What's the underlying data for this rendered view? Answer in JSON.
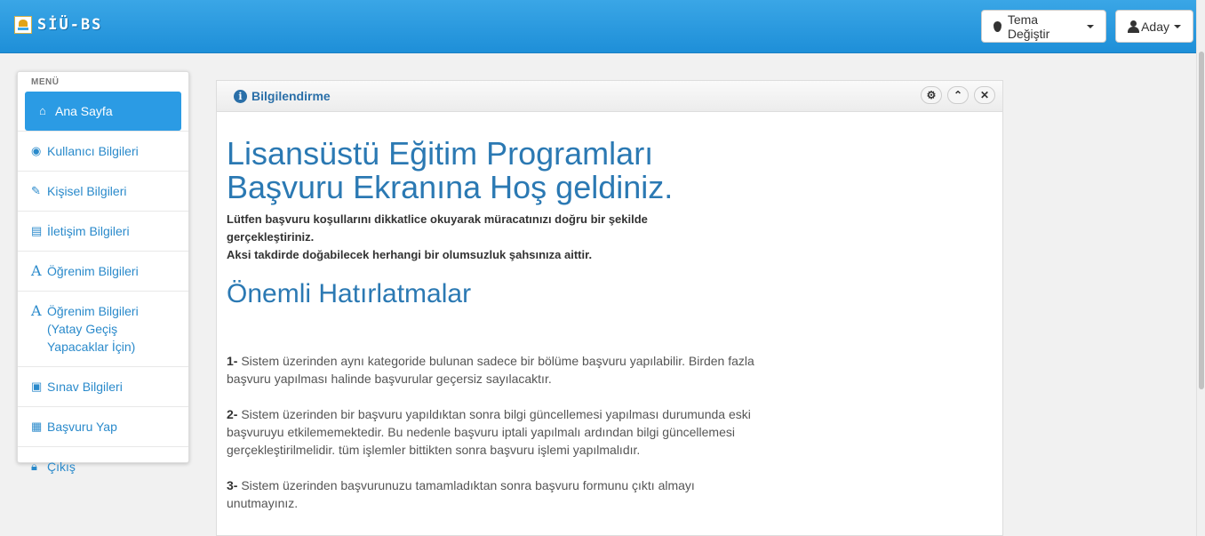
{
  "brand": {
    "name": "SİÜ-BS"
  },
  "navbar": {
    "theme_button": "Tema Değiştir",
    "user_button": "Aday"
  },
  "sidebar": {
    "title": "MENÜ",
    "items": [
      {
        "label": "Ana Sayfa",
        "icon": "home-icon"
      },
      {
        "label": "Kullanıcı Bilgileri",
        "icon": "eye-icon"
      },
      {
        "label": "Kişisel Bilgileri",
        "icon": "edit-icon"
      },
      {
        "label": "İletişim Bilgileri",
        "icon": "list-icon"
      },
      {
        "label": "Öğrenim Bilgileri",
        "icon": "font-icon"
      },
      {
        "label": "Öğrenim Bilgileri (Yatay Geçiş Yapacaklar İçin)",
        "icon": "font-icon"
      },
      {
        "label": "Sınav Bilgileri",
        "icon": "picture-icon"
      },
      {
        "label": "Başvuru Yap",
        "icon": "grid-icon"
      },
      {
        "label": "Çıkış",
        "icon": "lock-icon"
      }
    ]
  },
  "panel": {
    "title": "Bilgilendirme",
    "welcome": "Lisansüstü Eğitim Programları Başvuru Ekranına Hoş geldiniz.",
    "lead_1": "Lütfen başvuru koşullarını dikkatlice okuyarak müracatınızı doğru bir şekilde gerçekleştiriniz.",
    "lead_2": "Aksi takdirde doğabilecek herhangi bir olumsuzluk şahsınıza aittir.",
    "notes_title": "Önemli Hatırlatmalar",
    "notes": [
      {
        "num": "1-",
        "text": " Sistem üzerinden aynı kategoride bulunan sadece bir bölüme başvuru yapılabilir. Birden fazla başvuru yapılması halinde başvurular geçersiz sayılacaktır."
      },
      {
        "num": "2-",
        "text": " Sistem üzerinden bir başvuru yapıldıktan sonra bilgi güncellemesi yapılması durumunda eski başvuruyu etkilememektedir. Bu nedenle başvuru iptali yapılmalı ardından bilgi güncellemesi gerçekleştirilmelidir. tüm işlemler bittikten sonra başvuru işlemi yapılmalıdır."
      },
      {
        "num": "3-",
        "text": " Sistem üzerinden başvurunuzu tamamladıktan sonra başvuru formunu çıktı almayı unutmayınız."
      }
    ]
  },
  "colors": {
    "navbar": "#2b9be4",
    "active_item": "#2b9be4",
    "link": "#2a8acb",
    "heading": "#2b79b3"
  }
}
